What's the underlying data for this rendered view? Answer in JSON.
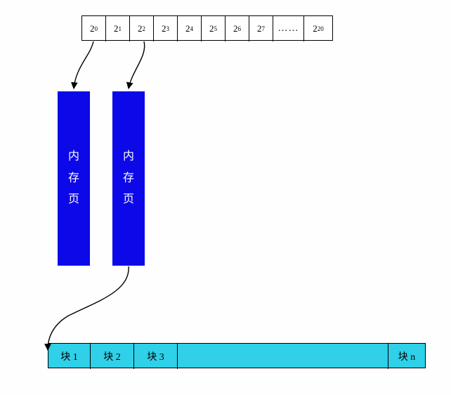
{
  "array_cells": {
    "c0": "0",
    "c1": "1",
    "c2": "2",
    "c3": "3",
    "c4": "4",
    "c5": "5",
    "c6": "6",
    "c7": "7",
    "dots": "……",
    "cN": "20",
    "base": "2"
  },
  "mem_page_label": {
    "ch1": "内",
    "ch2": "存",
    "ch3": "页"
  },
  "blocks": {
    "b1": "块 1",
    "b2": "块 2",
    "b3": "块 3",
    "bn": "块 n"
  }
}
